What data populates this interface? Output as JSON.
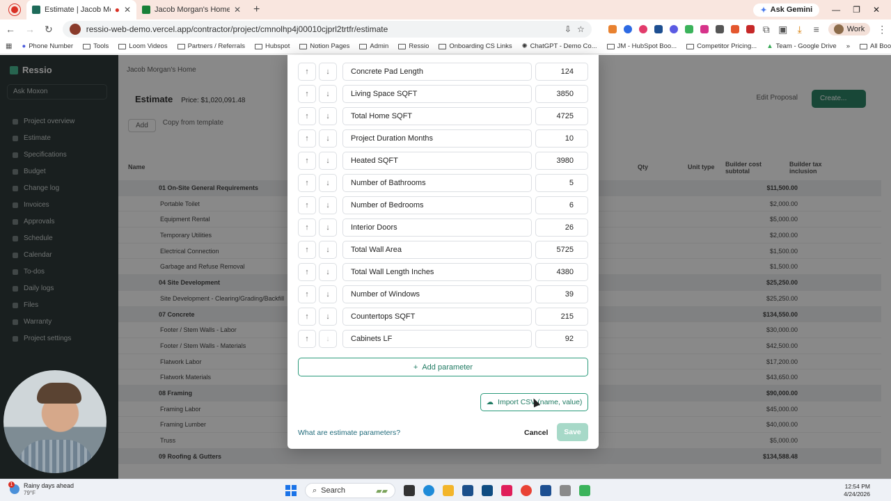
{
  "browser": {
    "tabs": [
      {
        "title": "Estimate | Jacob Morgan's",
        "active": true
      },
      {
        "title": "Jacob Morgan's Home (Parame",
        "active": false
      }
    ],
    "ask_gemini": "Ask Gemini",
    "url": "ressio-web-demo.vercel.app/contractor/project/cmnolhp4j00010cjprl2trtfr/estimate",
    "profile": "Work",
    "bookmarks": [
      "Phone Number",
      "Tools",
      "Loom Videos",
      "Partners / Referrals",
      "Hubspot",
      "Notion Pages",
      "Admin",
      "Ressio",
      "Onboarding CS Links",
      "ChatGPT - Demo Co...",
      "JM - HubSpot Boo...",
      "Competitor Pricing...",
      "Team - Google Drive"
    ],
    "all_bookmarks": "All Bookmarks"
  },
  "app": {
    "brand": "Ressio",
    "ask_button": "Ask Moxon",
    "sidebar_items": [
      "Project overview",
      "Estimate",
      "Specifications",
      "Budget",
      "Change log",
      "Invoices",
      "Approvals",
      "Schedule",
      "Calendar",
      "To-dos",
      "Daily logs",
      "Files",
      "Warranty",
      "Project settings"
    ],
    "breadcrumb": "Jacob Morgan's Home",
    "page_title": "Estimate",
    "price": "Price: $1,020,091.48",
    "bid_proposal": "Edit Proposal",
    "create_button": "Create...",
    "add_button": "Add",
    "copy_template": "Copy from template",
    "columns": {
      "name": "Name",
      "qty": "Qty",
      "unit_type": "Unit type",
      "builder_cost": "Builder cost subtotal",
      "builder_tax": "Builder tax inclusion"
    },
    "rows": [
      {
        "name": "01 On-Site General Requirements",
        "group": true,
        "amount": "$11,500.00"
      },
      {
        "name": "Portable Toilet",
        "group": false,
        "amount": "$2,000.00"
      },
      {
        "name": "Equipment Rental",
        "group": false,
        "amount": "$5,000.00"
      },
      {
        "name": "Temporary Utilities",
        "group": false,
        "amount": "$2,000.00"
      },
      {
        "name": "Electrical Connection",
        "group": false,
        "amount": "$1,500.00"
      },
      {
        "name": "Garbage and Refuse Removal",
        "group": false,
        "amount": "$1,500.00"
      },
      {
        "name": "04 Site Development",
        "group": true,
        "amount": "$25,250.00"
      },
      {
        "name": "Site Development - Clearing/Grading/Backfill",
        "group": false,
        "amount": "$25,250.00"
      },
      {
        "name": "07 Concrete",
        "group": true,
        "amount": "$134,550.00"
      },
      {
        "name": "Footer / Stem Walls - Labor",
        "group": false,
        "amount": "$30,000.00"
      },
      {
        "name": "Footer / Stem Walls - Materials",
        "group": false,
        "amount": "$42,500.00"
      },
      {
        "name": "Flatwork Labor",
        "group": false,
        "amount": "$17,200.00"
      },
      {
        "name": "Flatwork Materials",
        "group": false,
        "amount": "$43,650.00"
      },
      {
        "name": "08 Framing",
        "group": true,
        "amount": "$90,000.00"
      },
      {
        "name": "Framing Labor",
        "group": false,
        "amount": "$45,000.00"
      },
      {
        "name": "Framing Lumber",
        "group": false,
        "amount": "$40,000.00"
      },
      {
        "name": "Truss",
        "group": false,
        "amount": "$5,000.00"
      },
      {
        "name": "09 Roofing & Gutters",
        "group": true,
        "amount": "$134,588.48"
      }
    ]
  },
  "modal": {
    "parameters": [
      {
        "name": "Concrete Pad Length",
        "value": "124"
      },
      {
        "name": "Living Space SQFT",
        "value": "3850"
      },
      {
        "name": "Total Home SQFT",
        "value": "4725"
      },
      {
        "name": "Project Duration Months",
        "value": "10"
      },
      {
        "name": "Heated SQFT",
        "value": "3980"
      },
      {
        "name": "Number of Bathrooms",
        "value": "5"
      },
      {
        "name": "Number of Bedrooms",
        "value": "6"
      },
      {
        "name": "Interior Doors",
        "value": "26"
      },
      {
        "name": "Total Wall Area",
        "value": "5725"
      },
      {
        "name": "Total Wall Length Inches",
        "value": "4380"
      },
      {
        "name": "Number of Windows",
        "value": "39"
      },
      {
        "name": "Countertops SQFT",
        "value": "215"
      },
      {
        "name": "Cabinets LF",
        "value": "92"
      }
    ],
    "add_parameter": "Add parameter",
    "import_csv": "Import CSV (name, value)",
    "help_link": "What are estimate parameters?",
    "cancel": "Cancel",
    "save": "Save"
  },
  "taskbar": {
    "weather": "Rainy days ahead",
    "temperature": "79°F",
    "search_placeholder": "Search",
    "time": "12:54 PM",
    "date": "4/24/2026"
  },
  "colors": {
    "accent": "#1f7a62",
    "save_disabled": "#a7d9c8",
    "sidebar": "#1e2a2a",
    "tab_strip": "#f9e6df"
  }
}
